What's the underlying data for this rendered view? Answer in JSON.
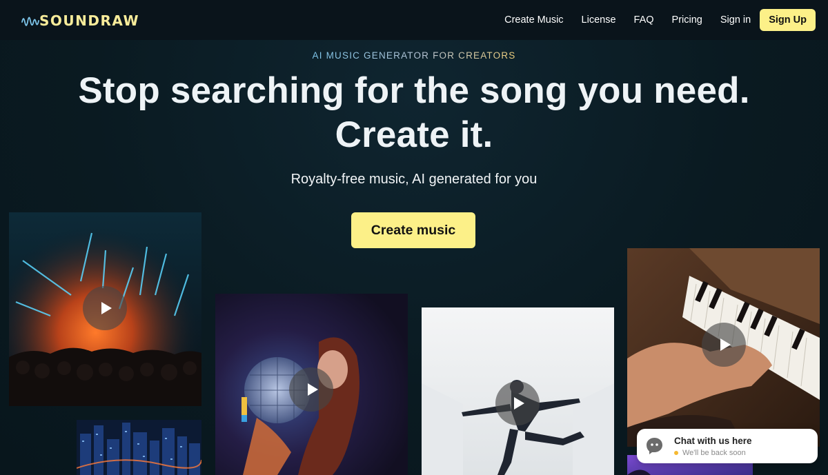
{
  "brand": {
    "name": "SOUNDRAW",
    "accent_color": "#fcf088"
  },
  "nav": {
    "items": [
      {
        "label": "Create Music"
      },
      {
        "label": "License"
      },
      {
        "label": "FAQ"
      },
      {
        "label": "Pricing"
      },
      {
        "label": "Sign in"
      }
    ],
    "signup_label": "Sign Up"
  },
  "hero": {
    "eyebrow": "AI MUSIC GENERATOR FOR CREATORS",
    "headline_line1": "Stop searching for the song you need.",
    "headline_line2": "Create it.",
    "subheadline": "Royalty-free music, AI generated for you",
    "cta_label": "Create music"
  },
  "media_tiles": [
    {
      "name": "concert",
      "icon": "play-icon"
    },
    {
      "name": "city-night",
      "icon": null
    },
    {
      "name": "disco-ball",
      "icon": "play-icon"
    },
    {
      "name": "dancer",
      "icon": "play-icon"
    },
    {
      "name": "piano",
      "icon": "play-icon"
    },
    {
      "name": "purple-sky",
      "icon": null
    }
  ],
  "chat_widget": {
    "title": "Chat with us here",
    "status": "We'll be back soon",
    "status_color": "#f5b931",
    "icon": "chat-bot-icon"
  }
}
